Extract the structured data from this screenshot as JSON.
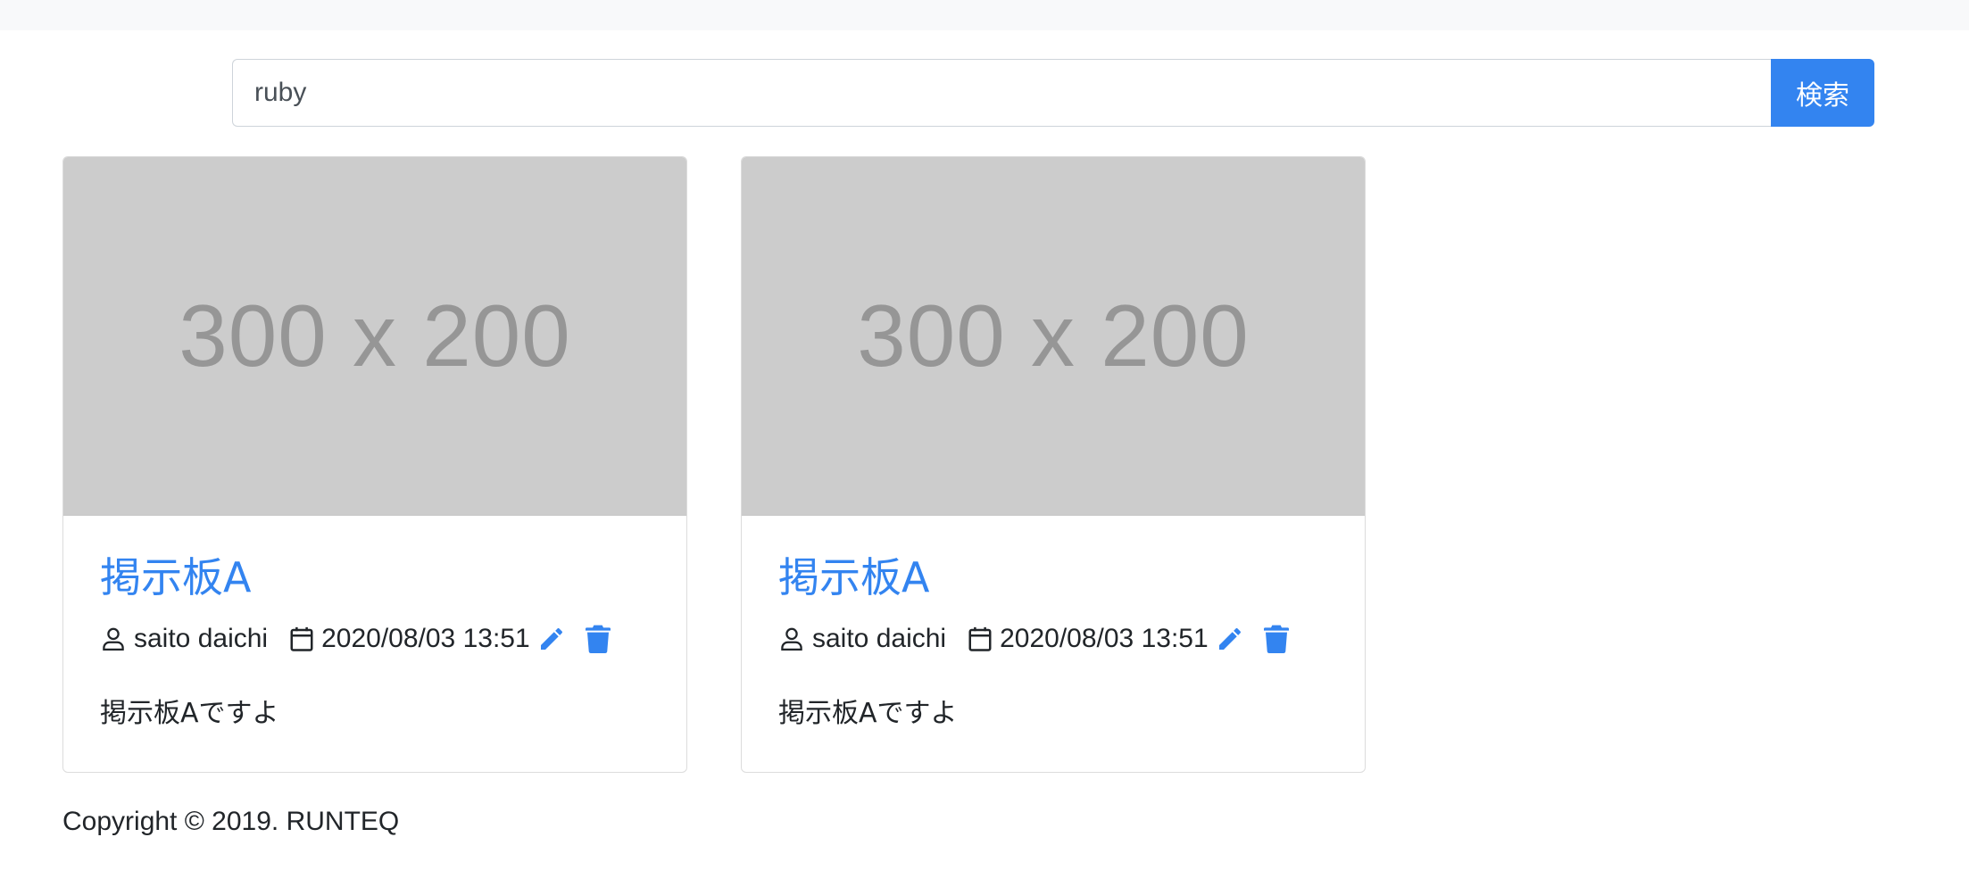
{
  "search": {
    "value": "ruby",
    "button_label": "検索"
  },
  "boards": [
    {
      "image_text": "300 x 200",
      "title": "掲示板A",
      "author": "saito daichi",
      "date": "2020/08/03 13:51",
      "description": "掲示板Aですよ"
    },
    {
      "image_text": "300 x 200",
      "title": "掲示板A",
      "author": "saito daichi",
      "date": "2020/08/03 13:51",
      "description": "掲示板Aですよ"
    }
  ],
  "footer": {
    "copyright": "Copyright © 2019. RUNTEQ"
  },
  "colors": {
    "accent": "#3384f0",
    "placeholder_bg": "#cccccc",
    "topbar_bg": "#f8f9fa"
  }
}
